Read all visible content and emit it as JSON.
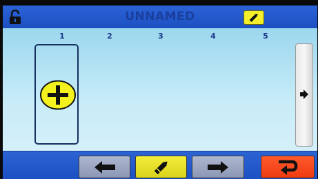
{
  "header": {
    "title": "UNNAMED",
    "lock_icon": "lock-open-icon",
    "edit_icon": "pencil-icon"
  },
  "columns": [
    "1",
    "2",
    "3",
    "4",
    "5"
  ],
  "slot": {
    "add_icon": "plus-circle-icon"
  },
  "side": {
    "next_icon": "arrow-right-icon"
  },
  "toolbar": {
    "prev_icon": "arrow-left-icon",
    "edit_icon": "pencil-icon",
    "next_icon": "arrow-right-icon",
    "return_icon": "return-arrow-icon"
  },
  "colors": {
    "bar_blue": "#1c4fc2",
    "panel_light_blue": "#c8ecf8",
    "accent_yellow": "#f3ef2a",
    "return_orange": "#ef3b10",
    "nav_gray": "#9aa4c0"
  }
}
